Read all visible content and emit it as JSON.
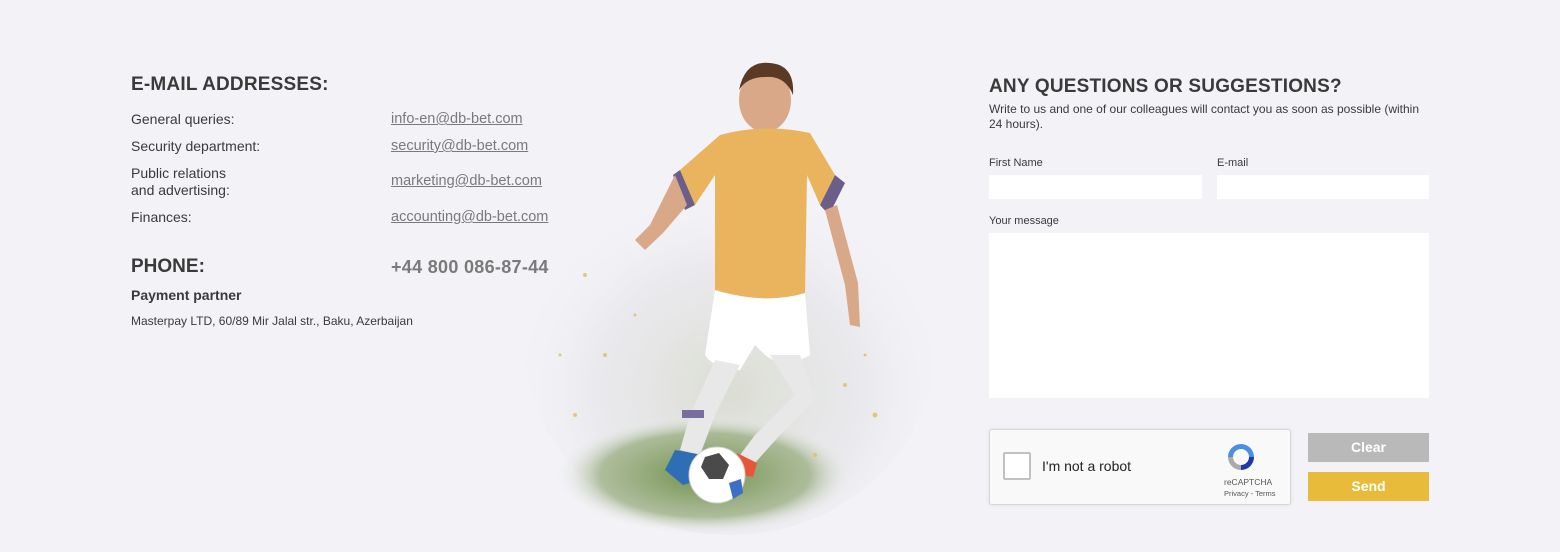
{
  "contacts": {
    "email_title": "E-MAIL ADDRESSES:",
    "rows": [
      {
        "label": "General queries:",
        "email": "info-en@db-bet.com"
      },
      {
        "label": "Security department:",
        "email": "security@db-bet.com"
      },
      {
        "label": "Public relations",
        "label2": "and advertising:",
        "email": "marketing@db-bet.com"
      },
      {
        "label": "Finances:",
        "email": "accounting@db-bet.com"
      }
    ],
    "phone_label": "PHONE:",
    "phone_value": "+44 800 086-87-44",
    "partner_title": "Payment partner",
    "partner_address": "Masterpay LTD, 60/89 Mir Jalal str., Baku, Azerbaijan"
  },
  "form": {
    "title": "ANY QUESTIONS OR SUGGESTIONS?",
    "subtitle": "Write to us and one of our colleagues will contact you as soon as possible (within 24 hours).",
    "first_name_label": "First Name",
    "email_label": "E-mail",
    "message_label": "Your message",
    "captcha_text": "I'm not a robot",
    "captcha_brand": "reCAPTCHA",
    "captcha_terms": "Privacy - Terms",
    "clear_label": "Clear",
    "send_label": "Send"
  },
  "colors": {
    "background": "#f3f2f7",
    "accent_send": "#e8bc3a",
    "clear_button": "#b9b9b9",
    "link": "#7a7a7a"
  },
  "icons": {
    "captcha_logo": "recaptcha-icon",
    "illustration": "football-player-illustration"
  }
}
